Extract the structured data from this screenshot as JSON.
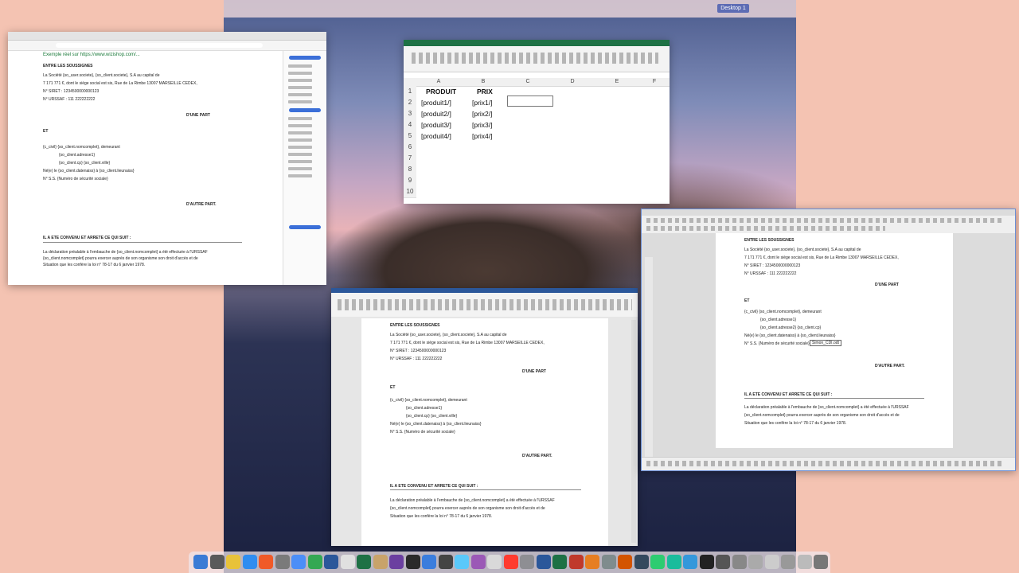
{
  "desktop": {
    "space_label": "Desktop 1"
  },
  "browser": {
    "header": "Exemple réel sur https://www.wizishop.com/...",
    "lines": [
      "ENTRE LES SOUSSIGNES",
      "La Société {so_user.societe}, {so_client.societe}, S.A au capital de",
      "7 171 771 €, dont le siège social est sis, Rue de La Rimbe 13007 MARSEILLE CEDEX,",
      "N° SIRET : 1234500000000123",
      "N° URSSAF : 111 222222222",
      "D'UNE PART",
      "ET",
      "{c_civil} {so_client.nomcomplet}, demeurant",
      "{so_client.adresse1}",
      "{so_client.cp} {so_client.ville}",
      "Né(e) le {so_client.datenaiss} à {so_client.lieunaiss}",
      "N° S.S. {Numéro de sécurité sociale}",
      "D'AUTRE PART.",
      "IL A ETE CONVENU ET ARRETE CE QUI SUIT :",
      "La déclaration préalable à l'embauche de {so_client.nomcomplet} a été effectuée à l'URSSAF",
      "{so_client.nomcomplet} pourra exercer auprès de son organisme son droit d'accès et de",
      "Situation que les confère la loi n° 78-17 du 6 janvier 1978."
    ]
  },
  "excel": {
    "columns": [
      "A",
      "B",
      "C",
      "D",
      "E",
      "F"
    ],
    "rows": [
      "1",
      "2",
      "3",
      "4",
      "5",
      "6",
      "7",
      "8",
      "9",
      "10"
    ],
    "header_produit": "PRODUIT",
    "header_prix": "PRIX",
    "produits": [
      "[produit1/]",
      "[produit2/]",
      "[produit3/]",
      "[produit4/]"
    ],
    "prix": [
      "[prix1/]",
      "[prix2/]",
      "[prix3/]",
      "[prix4/]"
    ]
  },
  "word": {
    "lines": [
      "ENTRE LES SOUSSIGNES",
      "La Société {so_user.societe}, {so_client.societe}, S.A au capital de",
      "7 171 771 €, dont le siège social est sis, Rue de La Rimbe 13007 MARSEILLE CEDEX,",
      "N° SIRET : 1234500000000123",
      "N° URSSAF : 111 222222222",
      "D'UNE PART",
      "ET",
      "{c_civil} {so_client.nomcomplet}, demeurant",
      "{so_client.adresse1}",
      "{so_client.cp} {so_client.ville}",
      "Né(e) le {so_client.datenaiss} à {so_client.lieunaiss}",
      "N° S.S. {Numéro de sécurité sociale}",
      "D'AUTRE PART.",
      "IL A ETE CONVENU ET ARRETE CE QUI SUIT :",
      "La déclaration préalable à l'embauche de {so_client.nomcomplet} a été effectuée à l'URSSAF",
      "{so_client.nomcomplet} pourra exercer auprès de son organisme son droit d'accès et de",
      "Situation que les confère la loi n° 78-17 du 6 janvier 1978."
    ]
  },
  "libre": {
    "field_box": "Simon_CDI.odt",
    "lines": [
      "ENTRE LES SOUSSIGNES",
      "La Société {so_user.societe}, {so_client.societe}, S.A au capital de",
      "7 171 771 €, dont le siège social est sis, Rue de La Rimbe 13007 MARSEILLE CEDEX,",
      "N° SIRET : 1234500000000123",
      "N° URSSAF : 111 222222222",
      "D'UNE PART",
      "ET",
      "{c_civil} {so_client.nomcomplet}, demeurant",
      "{so_client.adresse1}",
      "{so_client.adresse2} {so_client.cp}",
      "Né(e) le {so_client.datenaiss} à {so_client.lieunaiss}",
      "N° S.S. {Numéro de sécurité sociale}",
      "D'AUTRE PART.",
      "IL A ETE CONVENU ET ARRETE CE QUI SUIT :",
      "La déclaration préalable à l'embauche de {so_client.nomcomplet} a été effectuée à l'URSSAF",
      "{so_client.nomcomplet} pourra exercer auprès de son organisme son droit d'accès et de",
      "Situation que les confère la loi n° 78-17 du 6 janvier 1978."
    ]
  },
  "dock": {
    "colors": [
      "#3a7bd5",
      "#5a5a5a",
      "#e8c23a",
      "#2f8df0",
      "#f05a28",
      "#7a7a7a",
      "#4c8ef7",
      "#34a853",
      "#2b579a",
      "#e0e0e0",
      "#1e7145",
      "#c8a36a",
      "#6b3fa0",
      "#2a2a2a",
      "#3b7ddd",
      "#444",
      "#5ac8fa",
      "#9b59b6",
      "#d9d9d9",
      "#ff3b30",
      "#8e8e93",
      "#2b579a",
      "#1e7145",
      "#c0392b",
      "#e67e22",
      "#7f8c8d",
      "#d35400",
      "#34495e",
      "#2ecc71",
      "#1abc9c",
      "#3498db",
      "#222",
      "#555",
      "#888",
      "#aaa",
      "#ccc",
      "#999",
      "#bbb",
      "#777"
    ]
  }
}
